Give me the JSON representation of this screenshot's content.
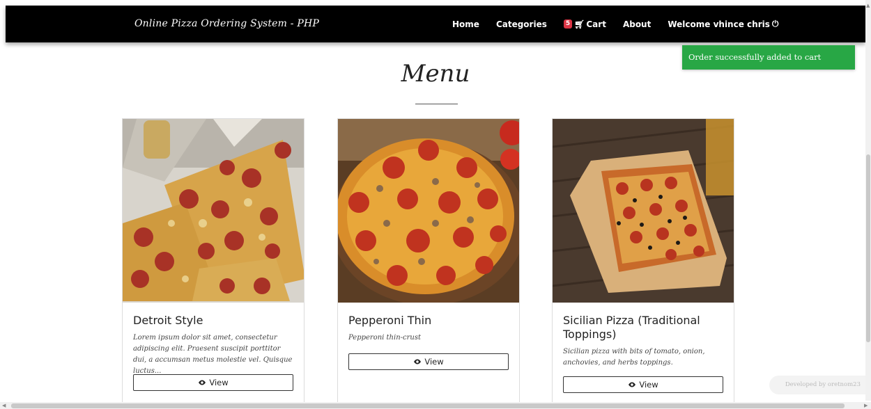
{
  "navbar": {
    "brand": "Online Pizza Ordering System - PHP",
    "items": [
      {
        "label": "Home"
      },
      {
        "label": "Categories"
      },
      {
        "label": "Cart",
        "badge": "5"
      },
      {
        "label": "About"
      },
      {
        "label": "Welcome vhince chris"
      }
    ]
  },
  "toast": {
    "message": "Order successfully added to cart",
    "color": "#28a745"
  },
  "page": {
    "title": "Menu"
  },
  "cards": [
    {
      "title": "Detroit Style",
      "description": "Lorem ipsum dolor sit amet, consectetur adipiscing elit. Praesent suscipit porttitor dui, a accumsan metus molestie vel. Quisque luctus...",
      "button": "View"
    },
    {
      "title": "Pepperoni Thin",
      "description": "Pepperoni thin-crust",
      "button": "View"
    },
    {
      "title": "Sicilian Pizza (Traditional Toppings)",
      "description": "Sicilian pizza with bits of tomato, onion, anchovies, and herbs toppings.",
      "button": "View"
    }
  ],
  "footer": {
    "credit": "Developed by oretnom23"
  },
  "icons": {
    "cart": "shopping-cart-icon",
    "logout": "power-icon",
    "view": "eye-icon"
  }
}
